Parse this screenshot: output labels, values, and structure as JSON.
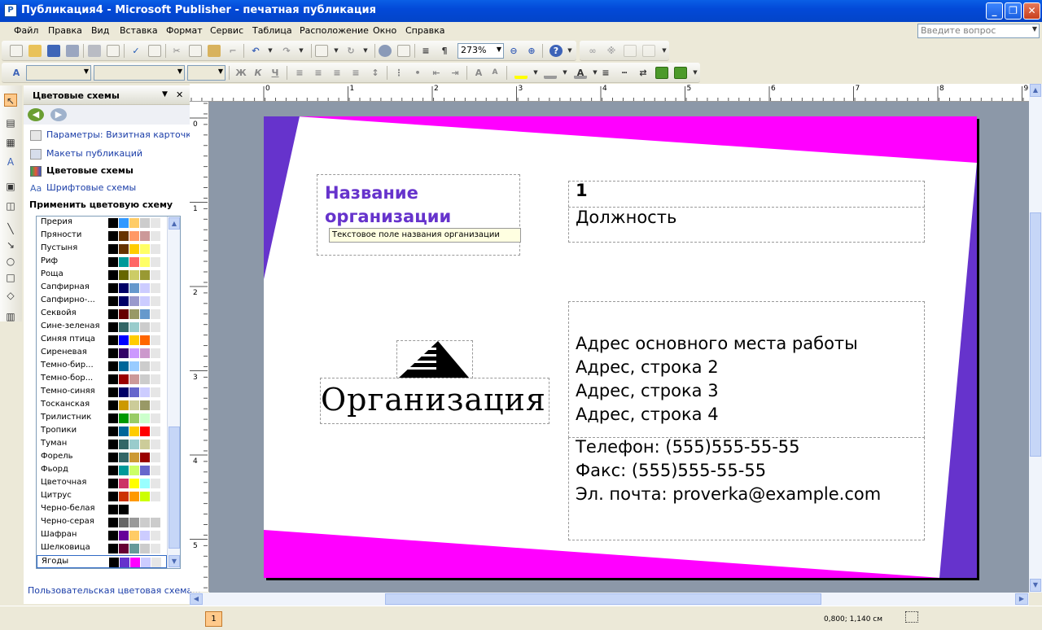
{
  "window": {
    "title": "Публикация4 - Microsoft Publisher - печатная публикация",
    "app_icon": "P",
    "minimize": "_",
    "maximize": "❐",
    "close": "✕"
  },
  "menu": {
    "items": [
      "Файл",
      "Правка",
      "Вид",
      "Вставка",
      "Формат",
      "Сервис",
      "Таблица",
      "Расположение",
      "Окно",
      "Справка"
    ],
    "ask_placeholder": "Введите вопрос"
  },
  "toolbar": {
    "zoom": "273%",
    "font": "",
    "size": ""
  },
  "task_pane": {
    "title": "Цветовые схемы",
    "links": [
      "Параметры: Визитная карточка",
      "Макеты публикаций",
      "Цветовые схемы",
      "Шрифтовые схемы"
    ],
    "apply_label": "Применить цветовую схему",
    "schemes": [
      {
        "name": "Прерия",
        "colors": [
          "#000000",
          "#3399ff",
          "#ffcc66",
          "#cccccc",
          "#e6e6e6"
        ]
      },
      {
        "name": "Пряности",
        "colors": [
          "#000000",
          "#663300",
          "#ff9966",
          "#cc9999",
          "#e6e6e6"
        ]
      },
      {
        "name": "Пустыня",
        "colors": [
          "#000000",
          "#663300",
          "#ffcc00",
          "#ffff66",
          "#e6e6e6"
        ]
      },
      {
        "name": "Риф",
        "colors": [
          "#000000",
          "#009999",
          "#ff6666",
          "#ffff66",
          "#e6e6e6"
        ]
      },
      {
        "name": "Роща",
        "colors": [
          "#000000",
          "#666600",
          "#cccc66",
          "#999933",
          "#e6e6e6"
        ]
      },
      {
        "name": "Сапфирная",
        "colors": [
          "#000000",
          "#000066",
          "#6699cc",
          "#ccccff",
          "#e6e6e6"
        ]
      },
      {
        "name": "Сапфирно-...",
        "colors": [
          "#000000",
          "#000066",
          "#9999cc",
          "#ccccff",
          "#e6e6e6"
        ]
      },
      {
        "name": "Секвойя",
        "colors": [
          "#000000",
          "#660000",
          "#999966",
          "#6699cc",
          "#e6e6e6"
        ]
      },
      {
        "name": "Сине-зеленая",
        "colors": [
          "#000000",
          "#336666",
          "#99cccc",
          "#cccccc",
          "#e6e6e6"
        ]
      },
      {
        "name": "Синяя птица",
        "colors": [
          "#000000",
          "#0000ff",
          "#ffcc00",
          "#ff6600",
          "#e6e6e6"
        ]
      },
      {
        "name": "Сиреневая",
        "colors": [
          "#000000",
          "#330066",
          "#cc99ff",
          "#cc99cc",
          "#e6e6e6"
        ]
      },
      {
        "name": "Темно-бир...",
        "colors": [
          "#000000",
          "#006699",
          "#99ccff",
          "#cccccc",
          "#e6e6e6"
        ]
      },
      {
        "name": "Темно-бор...",
        "colors": [
          "#000000",
          "#990000",
          "#cc9999",
          "#cccccc",
          "#e6e6e6"
        ]
      },
      {
        "name": "Темно-синяя",
        "colors": [
          "#000000",
          "#000066",
          "#6666cc",
          "#ccccff",
          "#e6e6e6"
        ]
      },
      {
        "name": "Тосканская",
        "colors": [
          "#000000",
          "#cc9900",
          "#cccc99",
          "#999966",
          "#e6e6e6"
        ]
      },
      {
        "name": "Трилистник",
        "colors": [
          "#000000",
          "#009900",
          "#99cc66",
          "#ccffcc",
          "#e6e6e6"
        ]
      },
      {
        "name": "Тропики",
        "colors": [
          "#000000",
          "#006699",
          "#ffcc00",
          "#ff0000",
          "#e6e6e6"
        ]
      },
      {
        "name": "Туман",
        "colors": [
          "#000000",
          "#336666",
          "#99cccc",
          "#cccc99",
          "#e6e6e6"
        ]
      },
      {
        "name": "Форель",
        "colors": [
          "#000000",
          "#336666",
          "#cc9933",
          "#990000",
          "#e6e6e6"
        ]
      },
      {
        "name": "Фьорд",
        "colors": [
          "#000000",
          "#009999",
          "#ccff66",
          "#6666cc",
          "#e6e6e6"
        ]
      },
      {
        "name": "Цветочная",
        "colors": [
          "#000000",
          "#cc3366",
          "#ffff00",
          "#99ffff",
          "#e6e6e6"
        ]
      },
      {
        "name": "Цитрус",
        "colors": [
          "#000000",
          "#cc3300",
          "#ff9900",
          "#ccff00",
          "#e6e6e6"
        ]
      },
      {
        "name": "Черно-белая",
        "colors": [
          "#000000",
          "#000000",
          "#ffffff",
          "#ffffff",
          "#ffffff"
        ]
      },
      {
        "name": "Черно-серая",
        "colors": [
          "#000000",
          "#666666",
          "#999999",
          "#cccccc",
          "#cccccc"
        ]
      },
      {
        "name": "Шафран",
        "colors": [
          "#000000",
          "#660099",
          "#ffcc66",
          "#ccccff",
          "#e6e6e6"
        ]
      },
      {
        "name": "Шелковица",
        "colors": [
          "#000000",
          "#660033",
          "#669999",
          "#cccccc",
          "#e6e6e6"
        ]
      },
      {
        "name": "Ягоды",
        "colors": [
          "#000000",
          "#6633cc",
          "#ff00ff",
          "#ccccff",
          "#e6e6e6"
        ]
      }
    ],
    "selected_scheme": "Ягоды",
    "custom_link": "Пользовательская цветовая схема..."
  },
  "rulers": {
    "h_ticks": [
      "0",
      "1",
      "2",
      "3",
      "4",
      "5",
      "6",
      "7",
      "8",
      "9"
    ],
    "v_ticks": [
      "0",
      "1",
      "2",
      "3",
      "4",
      "5"
    ]
  },
  "card": {
    "org_name": [
      "Название",
      "организации"
    ],
    "tooltip": "Текстовое поле названия организации",
    "name": "1",
    "position": "Должность",
    "address": [
      "Адрес основного места работы",
      "Адрес, строка 2",
      "Адрес, строка 3",
      "Адрес, строка 4"
    ],
    "contacts": [
      "Телефон: (555)555-55-55",
      "Факс: (555)555-55-55",
      "Эл. почта: proverka@example.com"
    ],
    "organization": "Организация",
    "colors": {
      "accent1": "#ff00ff",
      "accent2": "#6633cc",
      "org_name_color": "#6633cc"
    }
  },
  "status": {
    "page": "1",
    "coords": "0,800; 1,140 см"
  }
}
